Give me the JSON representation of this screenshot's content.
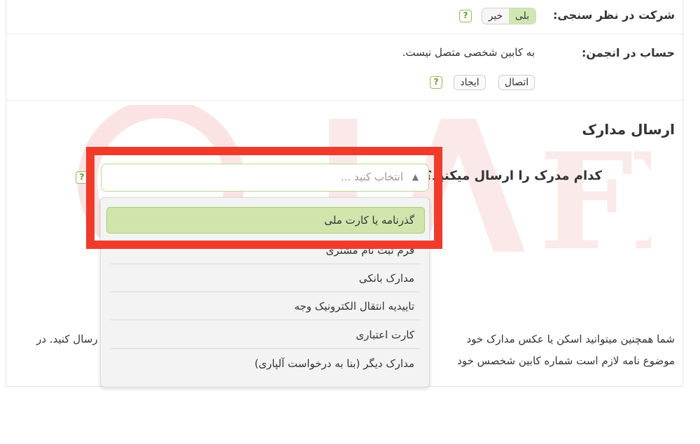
{
  "survey": {
    "label": "شرکت در نظر سنجی:",
    "yes": "بلی",
    "no": "خیر",
    "help": "?"
  },
  "forum": {
    "label": "حساب در انجمن:",
    "status": "به کابین شخصی متصل نیست.",
    "connect": "اتصال",
    "create": "ایجاد",
    "help": "?"
  },
  "documents": {
    "title": "ارسال مدارک",
    "question": "کدام مدرک را ارسال میکنید؟",
    "help": "?",
    "select_placeholder": "انتخاب کنید ...",
    "options": [
      "گذرنامه یا کارت ملی",
      "فرم ثبت نام مشتری",
      "مدارک بانکی",
      "تاییدیه انتقال الکترونیک وجه",
      "کارت اعتباری",
      "مدارک دیگر (بنا به درخواست آلپاری)"
    ],
    "info_line1_right": "شما همچنین میتوانید اسکن یا عکس مدارک خود",
    "info_line1_left": "رسال کنید. در",
    "info_line2_right": "موضوع نامه لازم است شماره کابین شخصس خود"
  },
  "colors": {
    "accent_green": "#cfe5ab",
    "highlight_red": "#f03b2b"
  }
}
